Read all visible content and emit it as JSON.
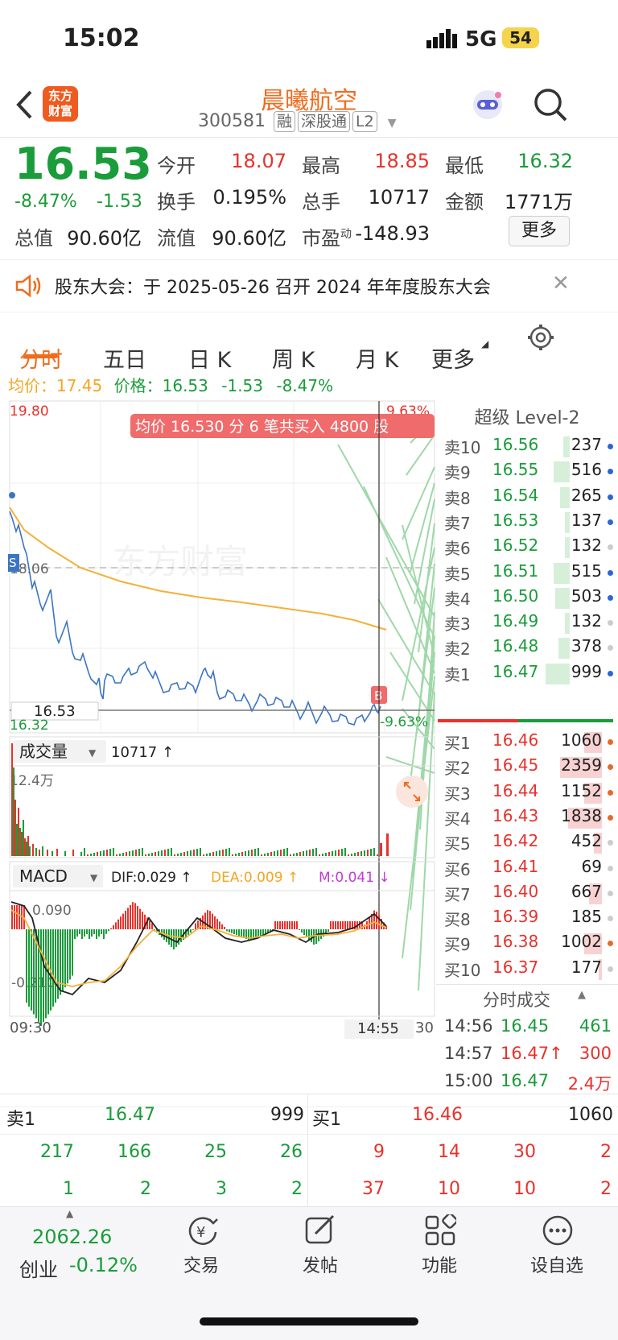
{
  "status_bar": {
    "time": "15:02",
    "network": "5G",
    "battery": "54"
  },
  "header": {
    "logo_line1": "东方",
    "logo_line2": "财富",
    "name": "晨曦航空",
    "code": "300581",
    "tags": [
      "融",
      "深股通",
      "L2"
    ]
  },
  "quote": {
    "price": "16.53",
    "change_pct": "-8.47%",
    "change": "-1.53",
    "fields": [
      {
        "label": "今开",
        "value": "18.07",
        "color": "#e8322c"
      },
      {
        "label": "最高",
        "value": "18.85",
        "color": "#e8322c"
      },
      {
        "label": "最低",
        "value": "16.32",
        "color": "#1a9c3a"
      },
      {
        "label": "换手",
        "value": "0.195%",
        "color": "#222"
      },
      {
        "label": "总手",
        "value": "10717",
        "color": "#222"
      },
      {
        "label": "金额",
        "value": "1771万",
        "color": "#222"
      },
      {
        "label": "总值",
        "value": "90.60亿",
        "color": "#222"
      },
      {
        "label": "流值",
        "value": "90.60亿",
        "color": "#222"
      },
      {
        "label": "市盈",
        "sup": "动",
        "value": "-148.93",
        "color": "#222"
      }
    ],
    "more_button": "更多"
  },
  "notice": {
    "text": "股东大会：于 2025-05-26 召开 2024 年年度股东大会"
  },
  "tabs": [
    "分时",
    "五日",
    "日 K",
    "周 K",
    "月 K",
    "更多"
  ],
  "summary_line": {
    "avg_label": "均价：",
    "avg_value": "17.45",
    "price_label": "价格：",
    "price_value": "16.53",
    "change": "-1.53",
    "change_pct": "-8.47%"
  },
  "chart_labels": {
    "y_top": "19.80",
    "y_mid": "18.06",
    "y_bottom": "16.32",
    "pct_top": "9.63%",
    "pct_bottom": "-9.63%",
    "current": "16.53",
    "tooltip": "均价 16.530  分 6 笔共买入 4800 股",
    "marker_s": "S",
    "marker_b": "B",
    "watermark": "东方财富"
  },
  "volume": {
    "label": "成交量",
    "value": "10717 ↑",
    "y_max": "12.4万"
  },
  "macd": {
    "label": "MACD",
    "dif": "DIF:0.029 ↑",
    "dea": "DEA:0.009 ↑",
    "m": "M:0.041 ↓",
    "y_top": "0.090",
    "y_bottom": "-0.210"
  },
  "time_axis": {
    "start": "09:30",
    "cursor": "14:55",
    "end": "30"
  },
  "level2": {
    "title": "超级 Level-2",
    "asks": [
      {
        "label": "卖10",
        "price": "16.56",
        "vol": "237"
      },
      {
        "label": "卖9",
        "price": "16.55",
        "vol": "516"
      },
      {
        "label": "卖8",
        "price": "16.54",
        "vol": "265"
      },
      {
        "label": "卖7",
        "price": "16.53",
        "vol": "137"
      },
      {
        "label": "卖6",
        "price": "16.52",
        "vol": "132"
      },
      {
        "label": "卖5",
        "price": "16.51",
        "vol": "515"
      },
      {
        "label": "卖4",
        "price": "16.50",
        "vol": "503"
      },
      {
        "label": "卖3",
        "price": "16.49",
        "vol": "132"
      },
      {
        "label": "卖2",
        "price": "16.48",
        "vol": "378"
      },
      {
        "label": "卖1",
        "price": "16.47",
        "vol": "999"
      }
    ],
    "bids": [
      {
        "label": "买1",
        "price": "16.46",
        "vol": "1060"
      },
      {
        "label": "买2",
        "price": "16.45",
        "vol": "2359"
      },
      {
        "label": "买3",
        "price": "16.44",
        "vol": "1152"
      },
      {
        "label": "买4",
        "price": "16.43",
        "vol": "1838"
      },
      {
        "label": "买5",
        "price": "16.42",
        "vol": "452"
      },
      {
        "label": "买6",
        "price": "16.41",
        "vol": "69"
      },
      {
        "label": "买7",
        "price": "16.40",
        "vol": "667"
      },
      {
        "label": "买8",
        "price": "16.39",
        "vol": "185"
      },
      {
        "label": "买9",
        "price": "16.38",
        "vol": "1002"
      },
      {
        "label": "买10",
        "price": "16.37",
        "vol": "177"
      }
    ],
    "trades_title": "分时成交",
    "trades": [
      {
        "time": "14:56",
        "price": "16.45",
        "vol": "461"
      },
      {
        "time": "14:57",
        "price": "16.47↑",
        "vol": "300"
      },
      {
        "time": "15:00",
        "price": "16.47",
        "vol": "2.4万"
      }
    ]
  },
  "queue": {
    "sell_label": "卖1",
    "sell_price": "16.47",
    "sell_vol": "999",
    "buy_label": "买1",
    "buy_price": "16.46",
    "buy_vol": "1060",
    "sell_row1": [
      "217",
      "166",
      "25",
      "26"
    ],
    "sell_row2": [
      "1",
      "2",
      "3",
      "2"
    ],
    "buy_row1": [
      "9",
      "14",
      "30",
      "2"
    ],
    "buy_row2": [
      "37",
      "10",
      "10",
      "2"
    ]
  },
  "bottom_nav": {
    "index_value": "2062.26",
    "index_name": "创业",
    "index_change": "-0.12%",
    "items": [
      "交易",
      "发帖",
      "功能",
      "设自选"
    ]
  }
}
